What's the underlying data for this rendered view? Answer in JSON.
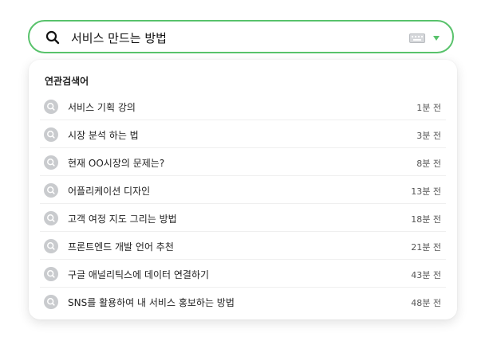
{
  "search": {
    "query": "서비스 만드는 방법"
  },
  "colors": {
    "accent": "#58c26b",
    "caret": "#58c26b",
    "icon_bg": "#c9cbce"
  },
  "icons": {
    "search": "search-icon",
    "keyboard": "keyboard-icon",
    "dropdown": "chevron-down-icon",
    "suggestion": "search-icon"
  },
  "suggestions": {
    "title": "연관검색어",
    "items": [
      {
        "label": "서비스 기획 강의",
        "time": "1분 전"
      },
      {
        "label": "시장 분석 하는 법",
        "time": "3분 전"
      },
      {
        "label": "현재 OO시장의 문제는?",
        "time": "8분 전"
      },
      {
        "label": "어플리케이션 디자인",
        "time": "13분 전"
      },
      {
        "label": "고객 여정 지도 그리는 방법",
        "time": "18분 전"
      },
      {
        "label": "프론트엔드 개발 언어 추천",
        "time": "21분 전"
      },
      {
        "label": "구글 애널리틱스에 데이터 연결하기",
        "time": "43분 전"
      },
      {
        "label": "SNS를 활용하여 내 서비스 홍보하는 방법",
        "time": "48분 전"
      }
    ]
  }
}
